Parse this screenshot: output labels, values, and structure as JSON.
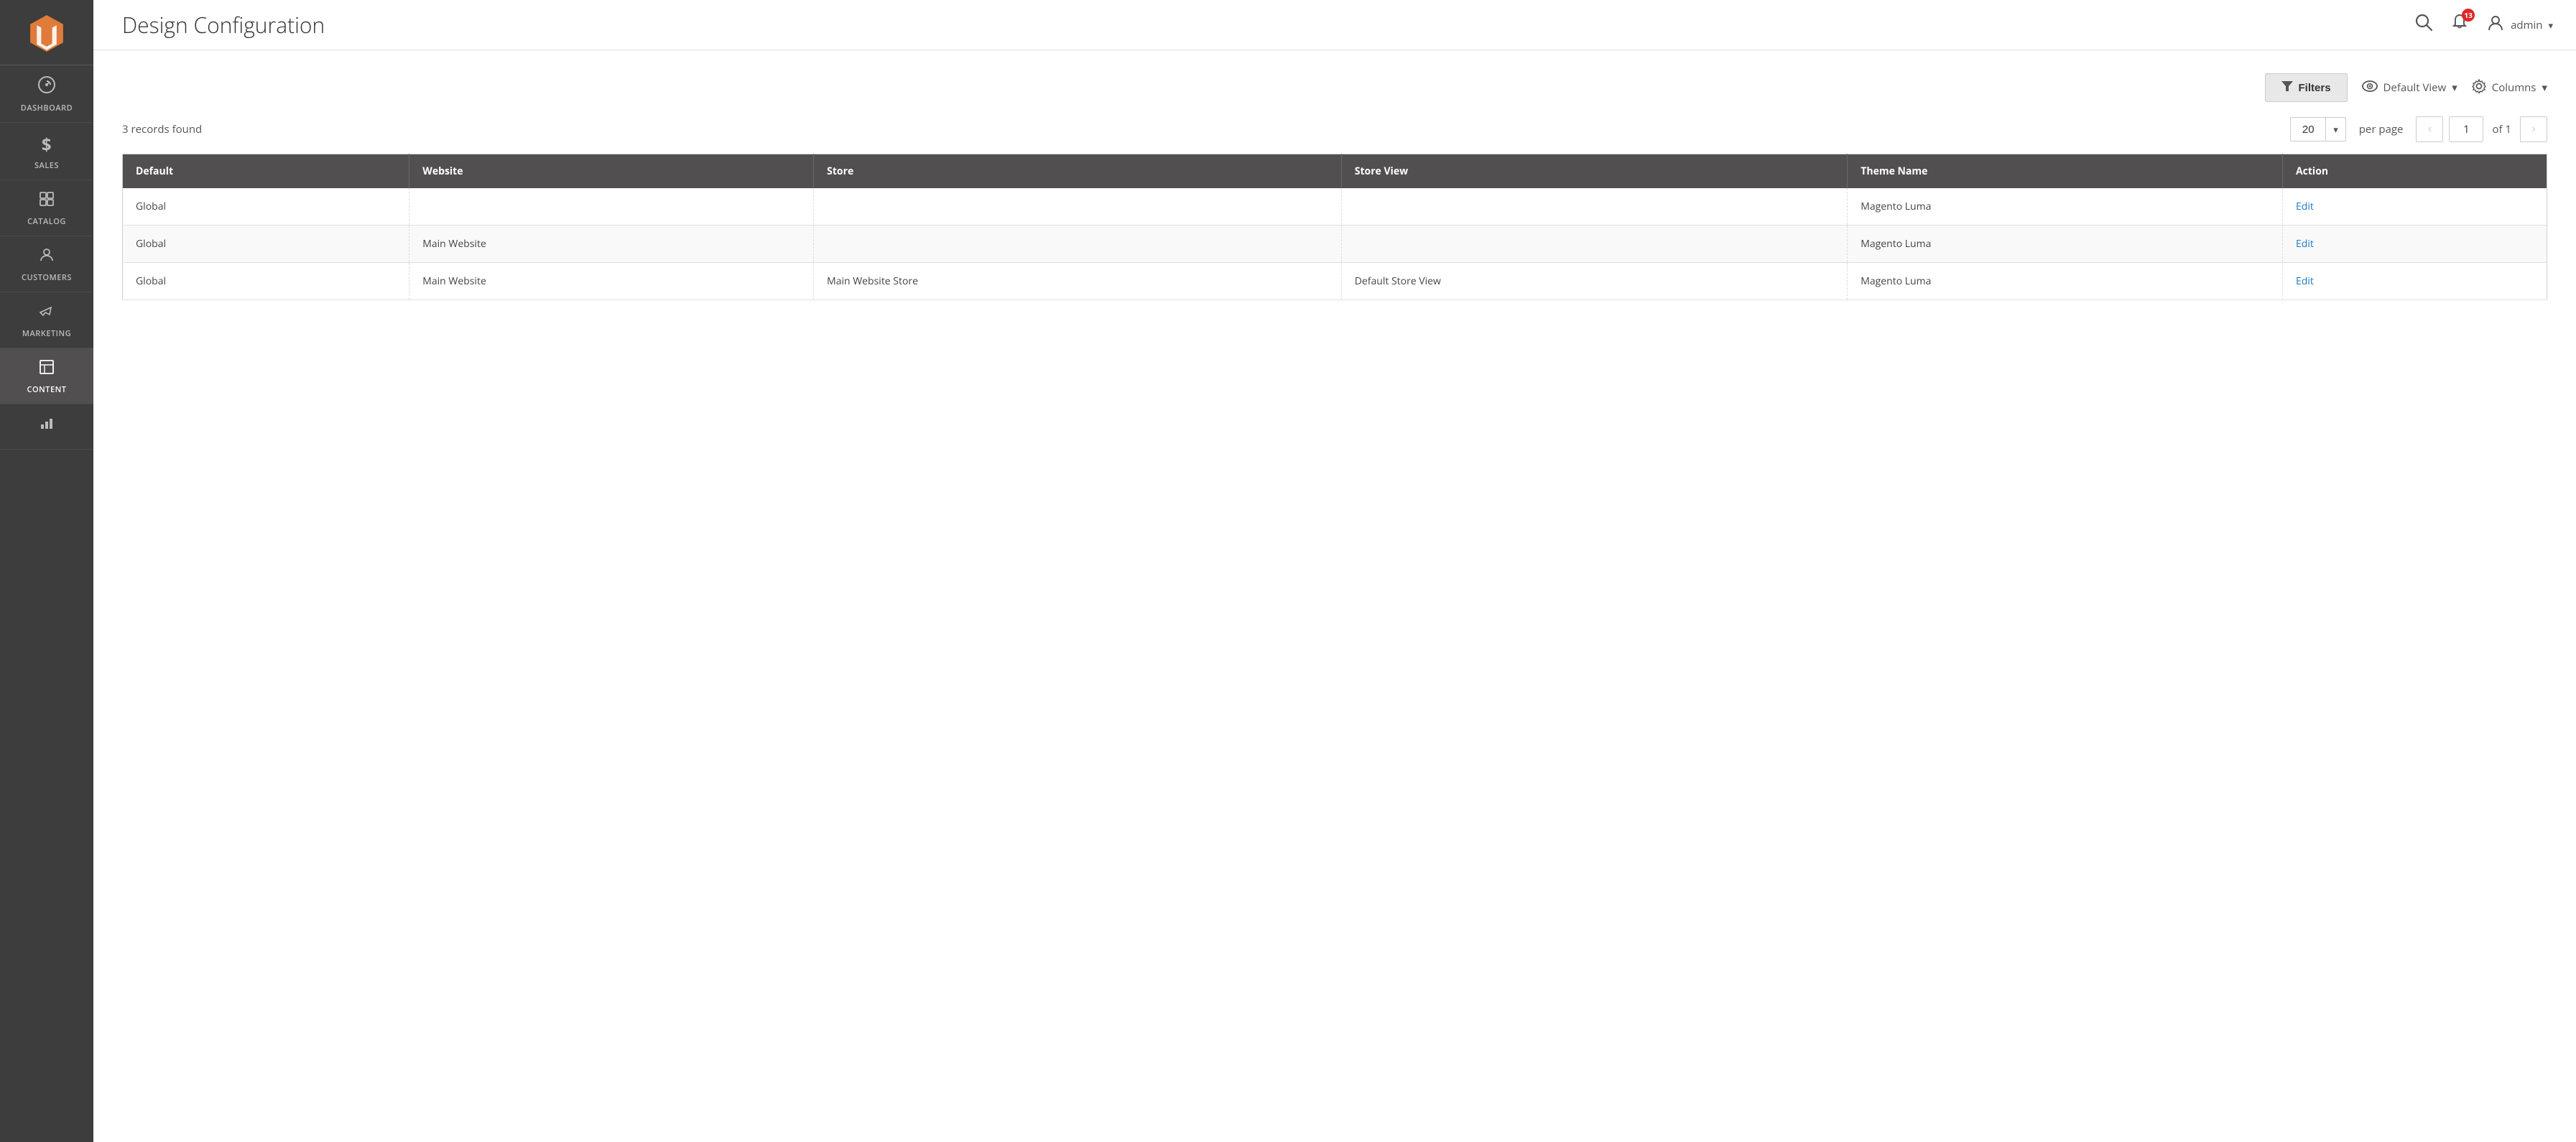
{
  "sidebar": {
    "logo_alt": "Magento Logo",
    "items": [
      {
        "id": "dashboard",
        "label": "DASHBOARD",
        "icon": "⊙"
      },
      {
        "id": "sales",
        "label": "SALES",
        "icon": "$"
      },
      {
        "id": "catalog",
        "label": "CATALOG",
        "icon": "📦"
      },
      {
        "id": "customers",
        "label": "CUSTOMERS",
        "icon": "👤"
      },
      {
        "id": "marketing",
        "label": "MARKETING",
        "icon": "📢"
      },
      {
        "id": "content",
        "label": "CONTENT",
        "icon": "⊞",
        "active": true
      },
      {
        "id": "reports",
        "label": "",
        "icon": "📊"
      }
    ]
  },
  "header": {
    "title": "Design Configuration",
    "search_title": "Search",
    "notification_count": "13",
    "user_name": "admin",
    "user_chevron": "▾"
  },
  "toolbar": {
    "filters_label": "Filters",
    "view_label": "Default View",
    "columns_label": "Columns",
    "view_chevron": "▾",
    "columns_chevron": "▾"
  },
  "records": {
    "summary": "3 records found",
    "per_page": "20",
    "per_page_label": "per page",
    "current_page": "1",
    "of_label": "of 1"
  },
  "table": {
    "columns": [
      {
        "id": "default",
        "label": "Default"
      },
      {
        "id": "website",
        "label": "Website"
      },
      {
        "id": "store",
        "label": "Store"
      },
      {
        "id": "store_view",
        "label": "Store View"
      },
      {
        "id": "theme_name",
        "label": "Theme Name"
      },
      {
        "id": "action",
        "label": "Action"
      }
    ],
    "rows": [
      {
        "default": "Global",
        "website": "",
        "store": "",
        "store_view": "",
        "theme_name": "Magento Luma",
        "action": "Edit"
      },
      {
        "default": "Global",
        "website": "Main Website",
        "store": "",
        "store_view": "",
        "theme_name": "Magento Luma",
        "action": "Edit"
      },
      {
        "default": "Global",
        "website": "Main Website",
        "store": "Main Website Store",
        "store_view": "Default Store View",
        "theme_name": "Magento Luma",
        "action": "Edit"
      }
    ]
  },
  "colors": {
    "sidebar_bg": "#3d3d3d",
    "table_header_bg": "#514f4f",
    "accent": "#e07b39",
    "link": "#1979c3",
    "badge_bg": "#e22626"
  }
}
